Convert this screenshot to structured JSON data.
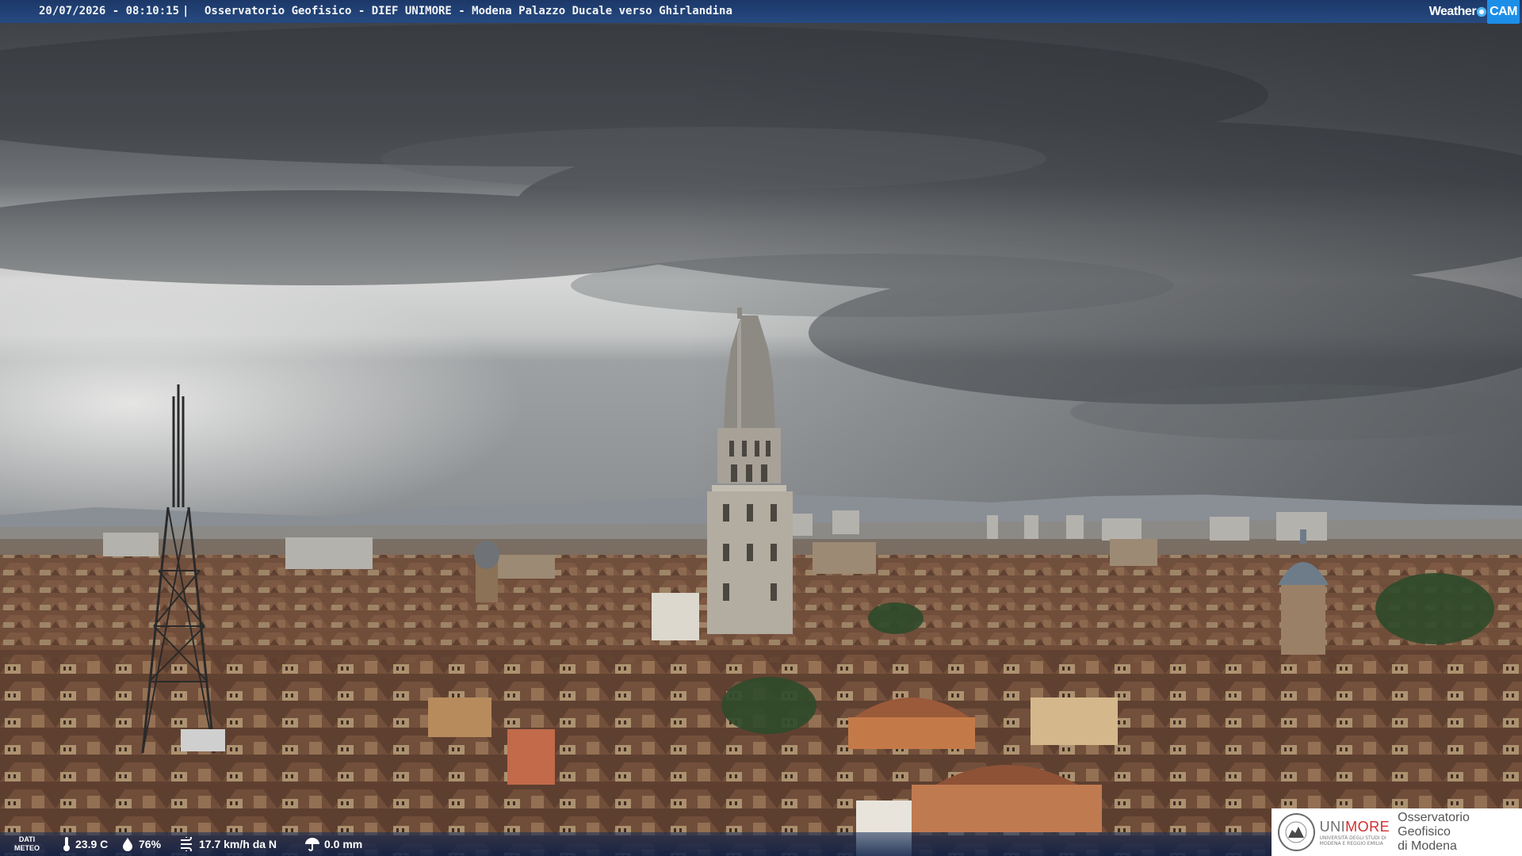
{
  "caption": {
    "timestamp": "20/07/2026 - 08:10:15",
    "separator": "|",
    "title": "Osservatorio Geofisico - DIEF UNIMORE - Modena Palazzo Ducale verso Ghirlandina"
  },
  "brand": {
    "weather": "Weather",
    "cam": "CAM"
  },
  "weather_bar": {
    "label_line1": "DATI",
    "label_line2": "METEO",
    "temperature": "23.9 C",
    "humidity": "76%",
    "wind": "17.7 km/h da N",
    "rain": "0.0 mm"
  },
  "logo": {
    "uni_prefix": "UNI",
    "uni_suffix": "MORE",
    "uni_sub1": "UNIVERSITÀ DEGLI STUDI DI",
    "uni_sub2": "MODENA E REGGIO EMILIA",
    "obs_line1": "Osservatorio Geofisico",
    "obs_line2": "di Modena"
  },
  "colors": {
    "bar_blue": "#1c3868",
    "accent_cam": "#1d8ee8",
    "unimore_red": "#d32e2e"
  }
}
